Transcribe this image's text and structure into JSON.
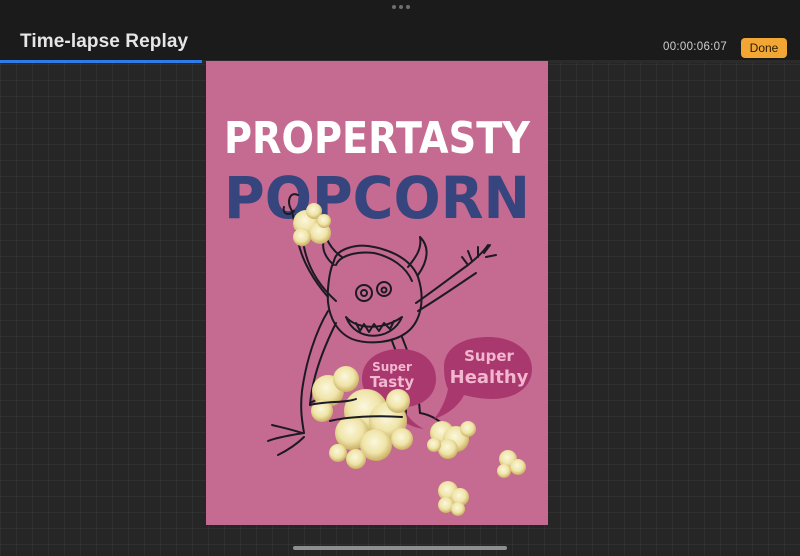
{
  "window": {
    "title": "Time-lapse Replay",
    "timecode": "00:00:06:07",
    "done_label": "Done",
    "playback_progress": 0.25
  },
  "artwork": {
    "headline_top": "PROPERTASTY",
    "headline_main": "POPCORN",
    "bubble_left_line1": "Super",
    "bubble_left_line2": "Tasty",
    "bubble_right_line1": "Super",
    "bubble_right_line2": "Healthy",
    "background_color": "#c56a90",
    "headline_main_color": "#36457e",
    "bubble_color": "#a8386e"
  },
  "icons": {
    "grabber": "ellipsis-grabber-icon"
  }
}
